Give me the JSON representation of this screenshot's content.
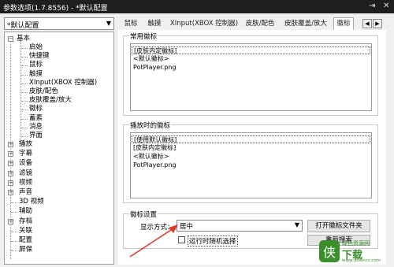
{
  "window": {
    "title": "参数选项(1.7.8556) - *默认配置",
    "pin": "⇥",
    "close": "✕"
  },
  "preset": {
    "value": "*默认配置"
  },
  "tabs": [
    "鼠标",
    "触摸",
    "XInput(XBOX 控制器)",
    "皮肤/配色",
    "皮肤覆盖/放大",
    "徽标"
  ],
  "tab_active": "徽标",
  "tree": {
    "root": "基本",
    "children": [
      "启始",
      "快捷键",
      "鼠标",
      "触摸",
      "XInput(XBOX 控制器)",
      "皮肤/配色",
      "皮肤覆盖/放大",
      "徽标",
      "蓄素",
      "消息",
      "界面"
    ],
    "sections": [
      "播放",
      "字幕",
      "设备",
      "滤镜",
      "视频",
      "声音",
      "3D 视频",
      "辅助",
      "存档",
      "关联",
      "配置",
      "屏保"
    ],
    "expandable": [
      true,
      true,
      true,
      true,
      true,
      true,
      false,
      false,
      true,
      false,
      false,
      false
    ]
  },
  "common_logo": {
    "label": "常用徽标",
    "items": [
      "[皮肤内定徽标]",
      "<默认徽标>",
      "PotPlayer.png"
    ]
  },
  "playback_logo": {
    "label": "播放时的徽标",
    "items": [
      "[使用默认徽标]",
      "[皮肤内定徽标]",
      "<默认徽标>",
      "PotPlayer.png"
    ]
  },
  "settings": {
    "label": "徽标设置",
    "display_label": "显示方式：",
    "display_value": "居中",
    "open_folder": "打开徽标文件夹",
    "random_label": "运行时随机选择",
    "rescan": "重新搜索"
  },
  "watermark": {
    "brand": "绿色资源网",
    "big": "下载",
    "sub": "www.downcc.com"
  },
  "colors": {
    "titlebar": "#1e1e1e",
    "arrow": "#e03a2a",
    "watermark": "#3a8f2a"
  }
}
